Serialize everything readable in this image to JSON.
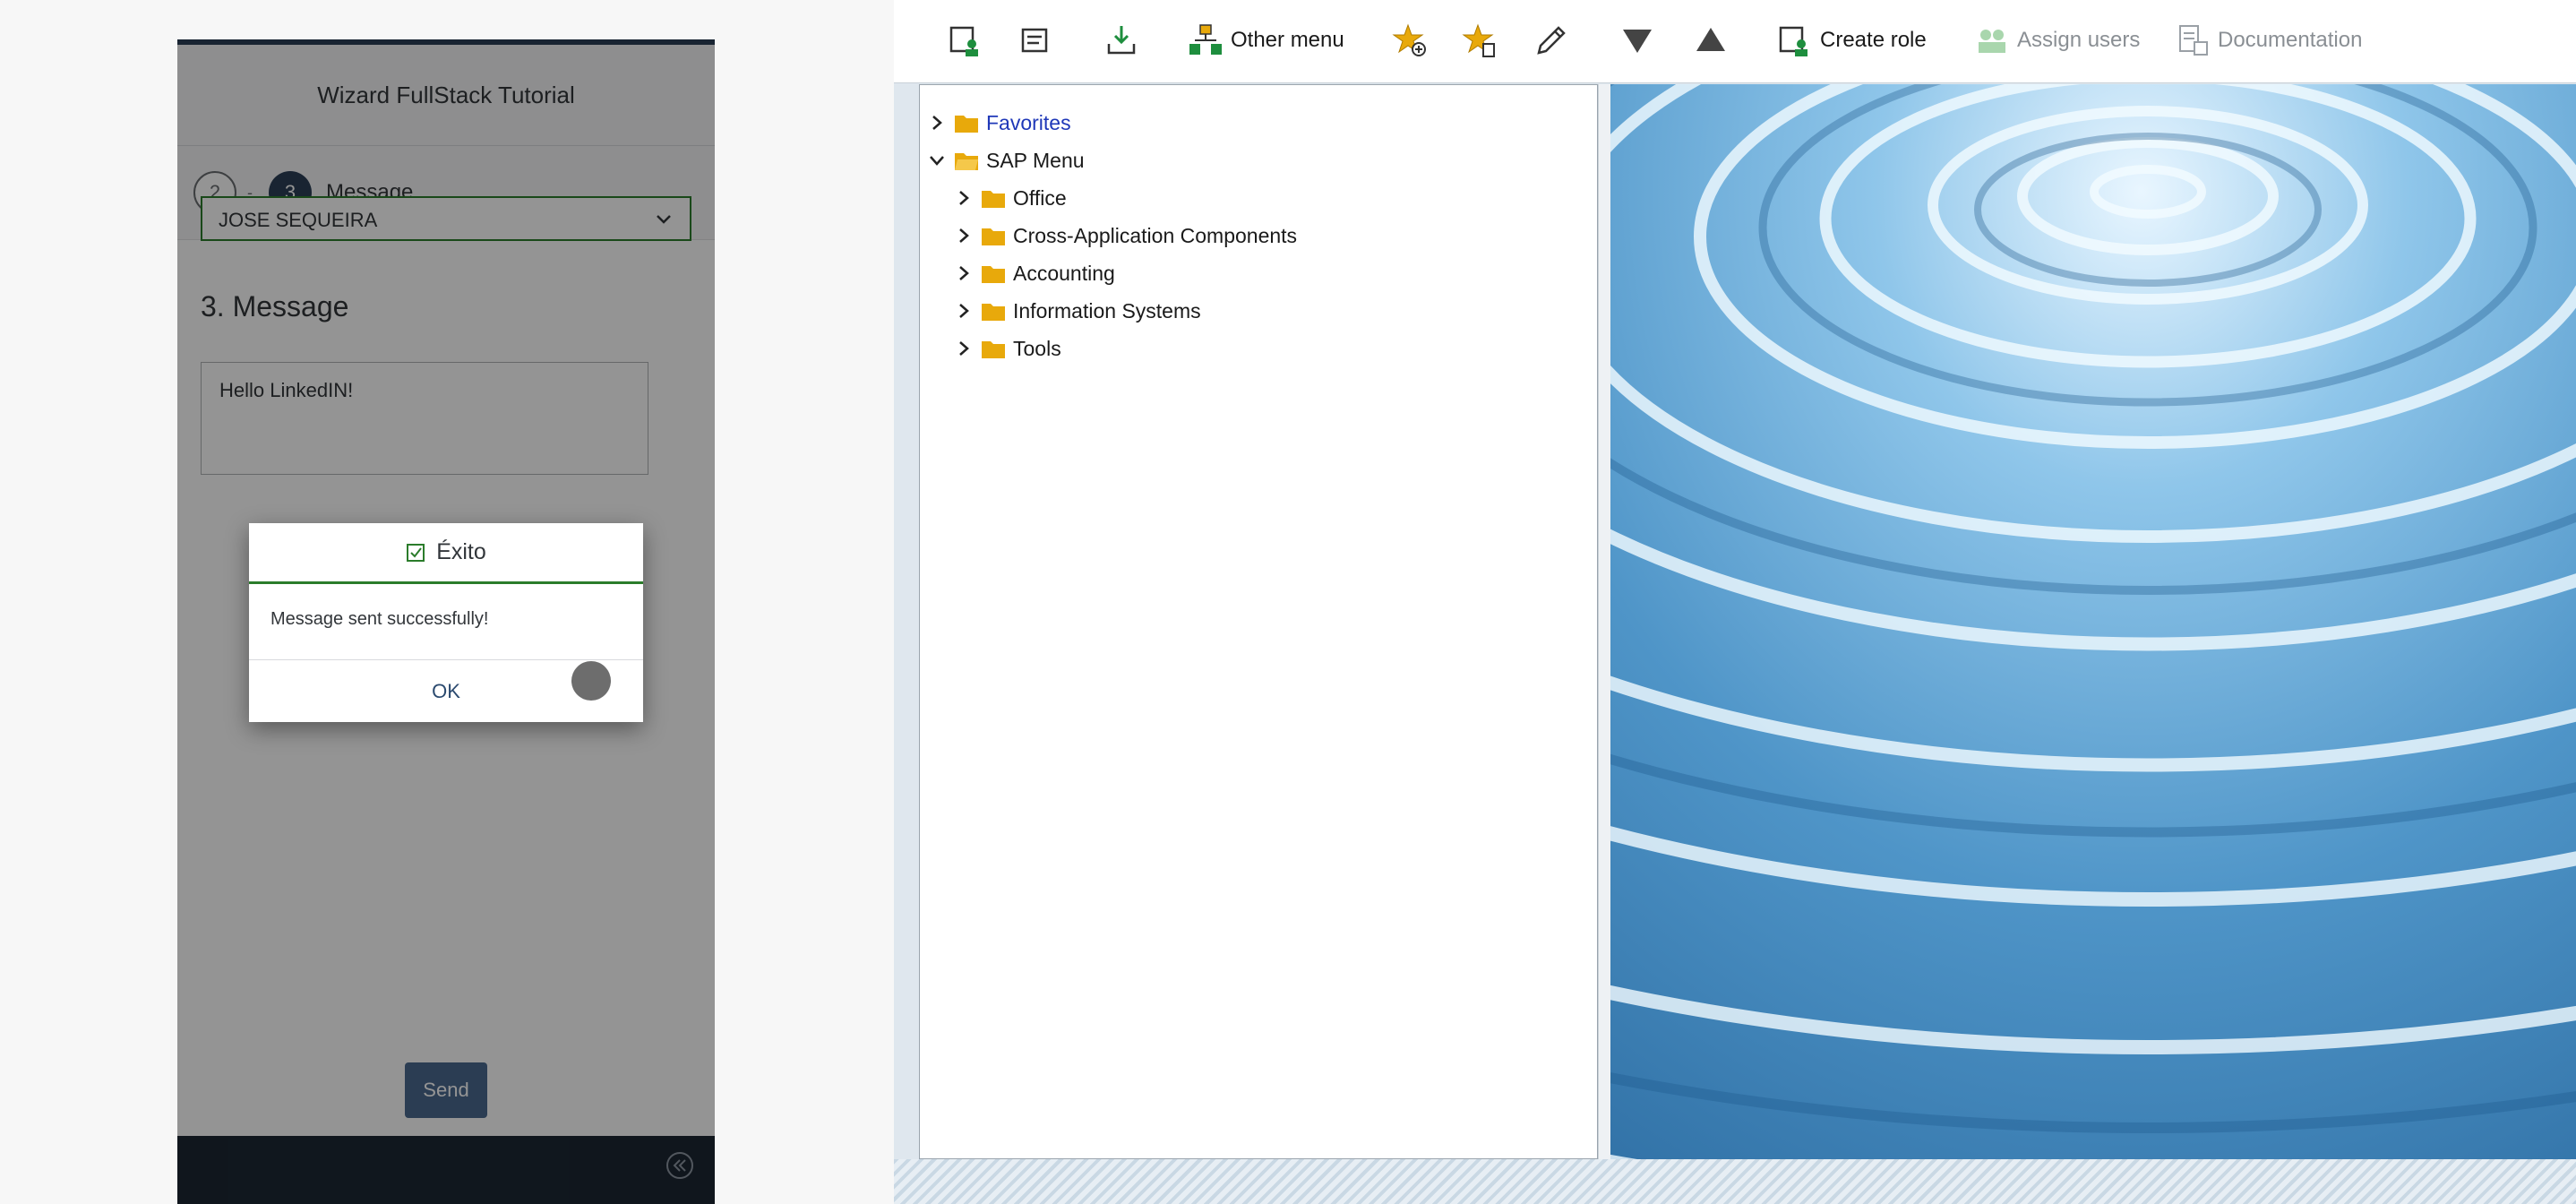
{
  "wizard": {
    "title": "Wizard FullStack Tutorial",
    "steps": [
      {
        "number": "2"
      },
      {
        "number": "3",
        "label": "Message"
      }
    ],
    "step_separator": "-",
    "recipient_value": "JOSE SEQUEIRA",
    "section_title": "3. Message",
    "message_value": "Hello LinkedIN!",
    "send_label": "Send",
    "dialog": {
      "title": "Éxito",
      "message": "Message sent successfully!",
      "ok_label": "OK",
      "accent": "#2b7c2b"
    },
    "accent": "#2b3f57"
  },
  "sap": {
    "toolbar": {
      "other_menu": "Other menu",
      "create_role": "Create role",
      "assign_users": "Assign users",
      "documentation": "Documentation"
    },
    "tree": {
      "favorites": "Favorites",
      "sap_menu": "SAP Menu",
      "children": [
        "Office",
        "Cross-Application Components",
        "Accounting",
        "Information Systems",
        "Tools"
      ]
    },
    "folder_color": "#e8a90b",
    "favorites_color": "#1f38b8"
  }
}
